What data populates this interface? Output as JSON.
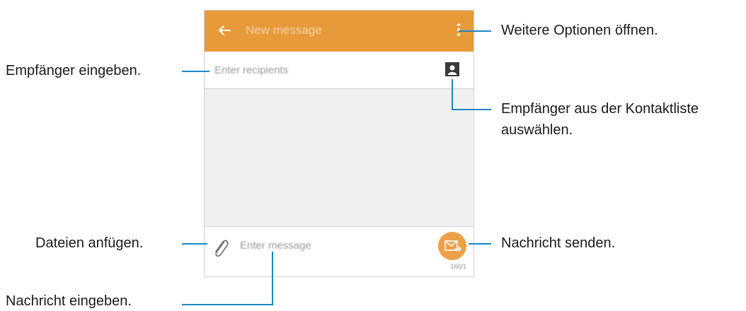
{
  "screen": {
    "title": "New message",
    "recipients_placeholder": "Enter recipients",
    "message_placeholder": "Enter message",
    "counter": "160/1",
    "accent_color": "#e69a3a",
    "send_button_color": "#eea048",
    "icons": {
      "back": "arrow-left-icon",
      "more": "more-vertical-icon",
      "contacts": "contact-card-icon",
      "attach": "paperclip-icon",
      "send": "envelope-send-icon"
    }
  },
  "callouts": {
    "more_options": "Weitere Optionen öffnen.",
    "enter_recipients": "Empfänger eingeben.",
    "pick_contacts_line1": "Empfänger aus der Kontaktliste",
    "pick_contacts_line2": "auswählen.",
    "attach_files": "Dateien anfügen.",
    "send_message": "Nachricht senden.",
    "enter_message": "Nachricht eingeben.",
    "leader_color": "#1a87c4"
  }
}
